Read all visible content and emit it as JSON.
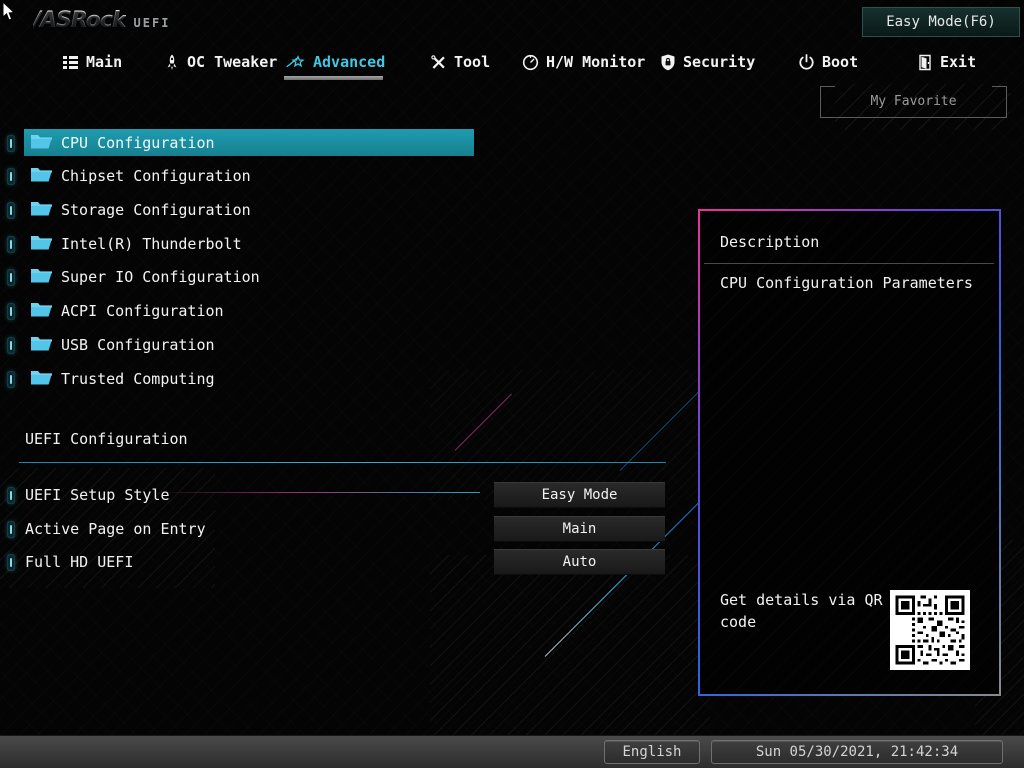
{
  "header": {
    "logo_text": "/ASRock",
    "logo_sub": "UEFI",
    "easy_mode_label": "Easy Mode(F6)",
    "my_favorite_label": "My Favorite"
  },
  "tabs": [
    {
      "label": "Main",
      "icon": "list-icon",
      "active": false
    },
    {
      "label": "OC Tweaker",
      "icon": "rocket-icon",
      "active": false
    },
    {
      "label": "Advanced",
      "icon": "star-icon",
      "active": true
    },
    {
      "label": "Tool",
      "icon": "tools-icon",
      "active": false
    },
    {
      "label": "H/W Monitor",
      "icon": "gauge-icon",
      "active": false
    },
    {
      "label": "Security",
      "icon": "shield-icon",
      "active": false
    },
    {
      "label": "Boot",
      "icon": "power-icon",
      "active": false
    },
    {
      "label": "Exit",
      "icon": "exit-icon",
      "active": false
    }
  ],
  "menu_items": [
    {
      "label": "CPU Configuration",
      "selected": true
    },
    {
      "label": "Chipset Configuration",
      "selected": false
    },
    {
      "label": "Storage Configuration",
      "selected": false
    },
    {
      "label": "Intel(R) Thunderbolt",
      "selected": false
    },
    {
      "label": "Super IO Configuration",
      "selected": false
    },
    {
      "label": "ACPI Configuration",
      "selected": false
    },
    {
      "label": "USB Configuration",
      "selected": false
    },
    {
      "label": "Trusted Computing",
      "selected": false
    }
  ],
  "uefi_section": {
    "title": "UEFI Configuration",
    "settings": [
      {
        "label": "UEFI Setup Style",
        "value": "Easy Mode"
      },
      {
        "label": "Active Page on Entry",
        "value": "Main"
      },
      {
        "label": "Full HD UEFI",
        "value": "Auto"
      }
    ]
  },
  "description_panel": {
    "title": "Description",
    "body": "CPU Configuration Parameters",
    "qr_caption": "Get details via QR code"
  },
  "status_bar": {
    "language_label": "English",
    "datetime_label": "Sun 05/30/2021, 21:42:34"
  },
  "colors": {
    "accent_cyan": "#41c7e3",
    "selected_teal": "#1a8fa3",
    "panel_border_pink": "#f0309a",
    "panel_border_blue": "#2b63e0",
    "folder_cyan": "#58c8ea"
  }
}
